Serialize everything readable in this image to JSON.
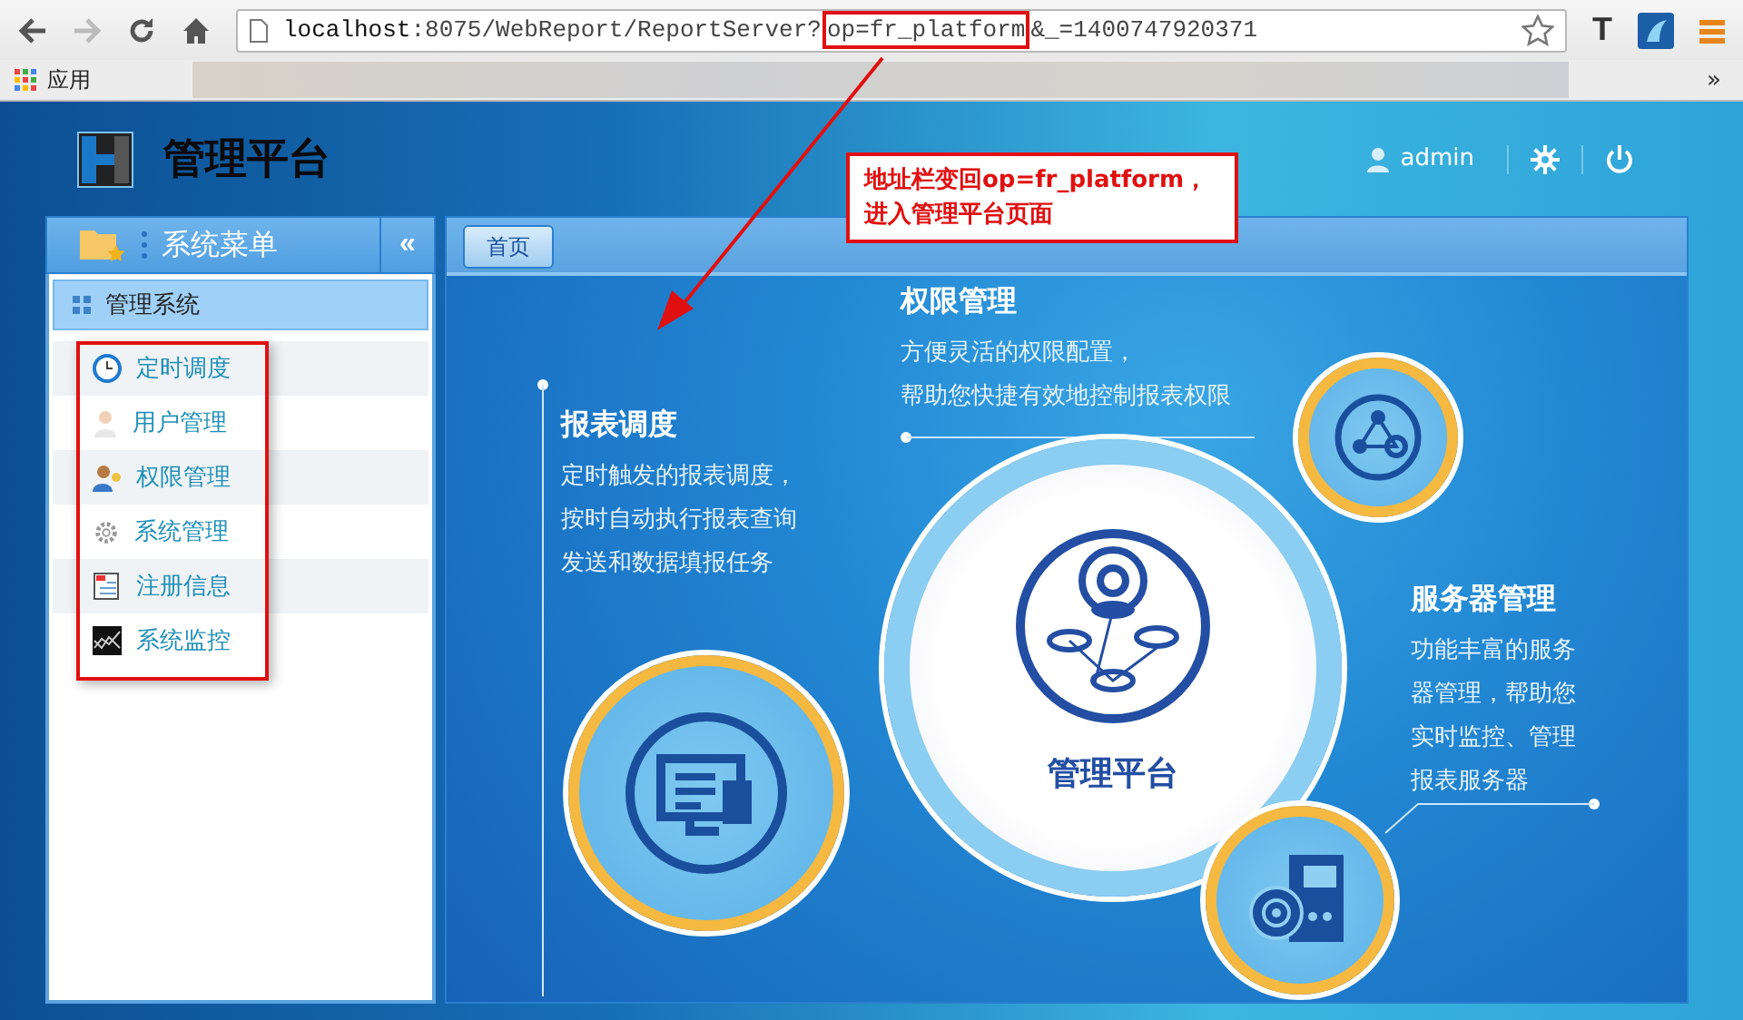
{
  "browser": {
    "url_host": "localhost",
    "url_path": ":8075/WebReport/ReportServer?",
    "url_param": "op=fr_platform",
    "url_tail": "&_=1400747920371",
    "extension_label": "T",
    "apps_label": "应用",
    "overflow": "»"
  },
  "header": {
    "title": "管理平台",
    "user": "admin"
  },
  "sidebar": {
    "title": "系统菜单",
    "collapse": "«",
    "group": {
      "label": "管理系统",
      "selected": true
    },
    "items": [
      {
        "label": "定时调度",
        "kind": "clock"
      },
      {
        "label": "用户管理",
        "kind": "user"
      },
      {
        "label": "权限管理",
        "kind": "permission"
      },
      {
        "label": "系统管理",
        "kind": "gear"
      },
      {
        "label": "注册信息",
        "kind": "register"
      },
      {
        "label": "系统监控",
        "kind": "monitor"
      }
    ]
  },
  "tabs": [
    {
      "label": "首页",
      "selected": true
    }
  ],
  "features": [
    {
      "title": "权限管理",
      "lines": [
        "方便灵活的权限配置，",
        "帮助您快捷有效地控制报表权限"
      ]
    },
    {
      "title": "报表调度",
      "lines": [
        "定时触发的报表调度，",
        "按时自动执行报表查询",
        "发送和数据填报任务"
      ]
    },
    {
      "title": "服务器管理",
      "lines": [
        "功能丰富的服务",
        "器管理，帮助您",
        "实时监控、管理",
        "报表服务器"
      ]
    }
  ],
  "hub_label": "管理平台",
  "annotation": {
    "lines": [
      "地址栏变回op=fr_platform，",
      "进入管理平台页面"
    ]
  }
}
